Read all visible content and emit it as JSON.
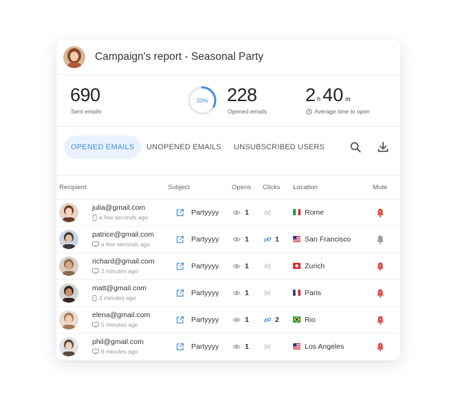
{
  "header": {
    "title": "Campaign's report - Seasonal Party"
  },
  "stats": {
    "sent": {
      "value": "690",
      "label": "Sent emails"
    },
    "opened": {
      "value": "228",
      "label": "Opened emails",
      "percent_label": "33%",
      "percent": 33
    },
    "avg_time": {
      "hours": "2",
      "hours_unit": "h",
      "minutes": "40",
      "minutes_unit": "m",
      "label": "Average time to open"
    }
  },
  "tabs": [
    {
      "label": "OPENED EMAILS",
      "active": true
    },
    {
      "label": "UNOPENED EMAILS",
      "active": false
    },
    {
      "label": "UNSUBSCRIBED USERS",
      "active": false
    }
  ],
  "toolbar": {
    "search_icon": "search-icon",
    "download_icon": "download-icon"
  },
  "columns": {
    "recipient": "Recipient",
    "subject": "Subject",
    "opens": "Opens",
    "clicks": "Clicks",
    "location": "Location",
    "mute": "Mute"
  },
  "rows": [
    {
      "email": "julia@gmail.com",
      "device": "mobile",
      "time": "a few seconds ago",
      "subject": "Partyyyy",
      "opens": "1",
      "clicks": "",
      "location": "Rome",
      "flag": "it",
      "muted": false
    },
    {
      "email": "patrice@gmail.com",
      "device": "desktop",
      "time": "a few seconds ago",
      "subject": "Partyyyy",
      "opens": "1",
      "clicks": "1",
      "location": "San Francisco",
      "flag": "us",
      "muted": true
    },
    {
      "email": "richard@gmail.com",
      "device": "desktop",
      "time": "2 minutes ago",
      "subject": "Partyyyy",
      "opens": "1",
      "clicks": "",
      "location": "Zurich",
      "flag": "ch",
      "muted": false
    },
    {
      "email": "matt@gmail.com",
      "device": "mobile",
      "time": "3 minutes ago",
      "subject": "Partyyyy",
      "opens": "1",
      "clicks": "",
      "location": "Paris",
      "flag": "fr",
      "muted": false
    },
    {
      "email": "elena@gmail.com",
      "device": "desktop",
      "time": "5 minutes ago",
      "subject": "Partyyyy",
      "opens": "1",
      "clicks": "2",
      "location": "Rio",
      "flag": "br",
      "muted": false
    },
    {
      "email": "phil@gmail.com",
      "device": "desktop",
      "time": "6 minutes ago",
      "subject": "Partyyyy",
      "opens": "1",
      "clicks": "",
      "location": "Los Angeles",
      "flag": "us",
      "muted": false
    }
  ],
  "colors": {
    "accent": "#3f8fe0",
    "bell_active": "#e0473b",
    "bell_muted": "#9e9e9e"
  }
}
